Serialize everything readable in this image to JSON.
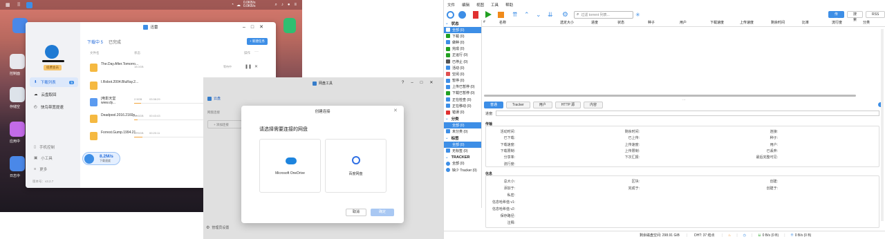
{
  "desktop": {
    "status_text_1": "0.0KB/s",
    "status_text_2": "0.0KB/s",
    "icons": [
      {
        "label": "控制面"
      },
      {
        "label": "存储空"
      },
      {
        "label": "应用中"
      },
      {
        "label": "日志中"
      }
    ]
  },
  "downloader": {
    "title": "迅雷",
    "vip_badge": "续费会员",
    "nav": [
      {
        "label": "下载列表",
        "badge": "5"
      },
      {
        "label": "云盘取回"
      },
      {
        "label": "快鸟带宽提速"
      }
    ],
    "bottom_nav": [
      {
        "label": "手机控制"
      },
      {
        "label": "小工具"
      },
      {
        "label": "更多"
      }
    ],
    "version": "版本号：v3.2.7",
    "speed": "8.2M/s",
    "speed_sub": "下载速度",
    "tabs": [
      {
        "label": "下载中 5"
      },
      {
        "label": "已完成"
      }
    ],
    "new_task": "+ 新建任务",
    "col_name": "文件名",
    "col_status": "状态",
    "col_action": "操作",
    "rows": [
      {
        "name": "The.Day.After.Tomorro...",
        "size": "18.0GB",
        "status": "等待中",
        "progress": 0.0
      },
      {
        "name": "I.Robot.2004.BluRay.2...",
        "size": "",
        "status": "",
        "progress": 0.0
      },
      {
        "name": "[电影天堂www.dy...",
        "size": "2.5GB",
        "status": "03:38:29",
        "progress": 0.1
      },
      {
        "name": "Deadpool.2016.2160p...",
        "size": "15.8GB",
        "status": "00:43:43",
        "progress": 0.05
      },
      {
        "name": "Forrest.Gump.1994.21...",
        "size": "17.9GB",
        "status": "00:20:11",
        "progress": 0.12
      }
    ]
  },
  "net_tool": {
    "title": "网盘工具",
    "section": "云盘",
    "sub": "网盘连接",
    "add": "+ 添加连接",
    "manage": "管理员设置"
  },
  "create_dialog": {
    "title": "创建连接",
    "prompt": "请选择需要连接的网盘",
    "option1": "Microsoft OneDrive",
    "option2": "百度网盘",
    "cancel": "取消",
    "ok": "确定"
  },
  "qbt": {
    "menu": [
      "文件",
      "编辑",
      "视图",
      "工具",
      "帮助"
    ],
    "search_placeholder": "过滤 torrent 列表...",
    "view_buttons": [
      "传输",
      "搜索",
      "RSS"
    ],
    "status_header": "状态",
    "status_items": [
      {
        "label": "全部 (0)",
        "color": "#3d8ee6"
      },
      {
        "label": "下载 (0)",
        "color": "#21a021"
      },
      {
        "label": "做种 (0)",
        "color": "#3d8ee6"
      },
      {
        "label": "完成 (0)",
        "color": "#21a021"
      },
      {
        "label": "正运行 (0)",
        "color": "#21a021"
      },
      {
        "label": "已停止 (0)",
        "color": "#555555"
      },
      {
        "label": "活动 (0)",
        "color": "#3d8ee6"
      },
      {
        "label": "空闲 (0)",
        "color": "#e05050"
      },
      {
        "label": "暂停 (0)",
        "color": "#3d8ee6"
      },
      {
        "label": "上传已暂停 (0)",
        "color": "#3d8ee6"
      },
      {
        "label": "下载已暂停 (0)",
        "color": "#21a021"
      },
      {
        "label": "正在检查 (0)",
        "color": "#3d8ee6"
      },
      {
        "label": "正在移动 (0)",
        "color": "#3d8ee6"
      },
      {
        "label": "错误 (0)",
        "color": "#e03030"
      }
    ],
    "category_header": "分类",
    "category_items": [
      {
        "label": "全部 (0)"
      },
      {
        "label": "未分类 (0)"
      }
    ],
    "tag_header": "标签",
    "tag_items": [
      {
        "label": "全部 (0)"
      },
      {
        "label": "无标签 (0)"
      }
    ],
    "tracker_header": "TRACKER",
    "tracker_items": [
      {
        "label": "全部 (0)"
      },
      {
        "label": "缺少 Tracker (0)"
      }
    ],
    "columns": [
      "#",
      "名称",
      "选定大小",
      "进度",
      "状态",
      "种子",
      "用户",
      "下载速度",
      "上传速度",
      "剩余时间",
      "比率",
      "流行度",
      "分类"
    ],
    "detail_tabs": [
      "普通",
      "Tracker",
      "用户",
      "HTTP 源",
      "内容"
    ],
    "progress_label": "进度:",
    "transfer_header": "传输",
    "transfer_labels": [
      [
        "活动时间:",
        "剩余时间:",
        "连接:"
      ],
      [
        "已下载:",
        "已上传:",
        "种子:"
      ],
      [
        "下载速度:",
        "上传速度:",
        "用户:"
      ],
      [
        "下载限制:",
        "上传限制:",
        "已丢弃:"
      ],
      [
        "分享率:",
        "下次汇报:",
        "最后完整可见:"
      ],
      [
        "流行度:",
        "",
        ""
      ]
    ],
    "info_header": "信息",
    "info_labels": [
      [
        "总大小:",
        "区块:",
        "创建:"
      ],
      [
        "添加于:",
        "完成于:",
        "创建于:"
      ],
      [
        "私密:",
        "",
        ""
      ],
      [
        "信息哈希值 v1:",
        "",
        ""
      ],
      [
        "信息哈希值 v2:",
        "",
        ""
      ],
      [
        "保存路径:",
        "",
        ""
      ],
      [
        "注释:",
        "",
        ""
      ]
    ],
    "status_bar": {
      "free_space": "剩余磁盘空间: 298.91 GiB",
      "dht": "DHT: 37 结点",
      "down": "0 B/s (0 B)",
      "up": "0 B/s (0 B)"
    }
  }
}
